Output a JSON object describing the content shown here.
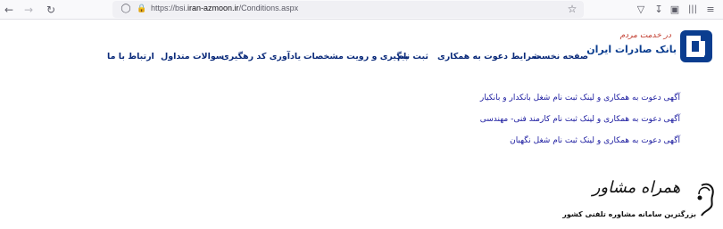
{
  "browser": {
    "url_prefix": "https://bsi.",
    "url_host": "iran-azmoon.ir",
    "url_path": "/Conditions.aspx",
    "icons": [
      "back-arrow-icon",
      "forward-arrow-icon",
      "reload-icon",
      "shield-icon",
      "lock-icon",
      "bookmark-star-icon",
      "pocket-icon",
      "download-icon",
      "extensions-icon",
      "library-icon",
      "hamburger-menu-icon"
    ]
  },
  "site": {
    "logo_name": "بانک صادرات ایران",
    "logo_slogan": "در خدمت مردم",
    "brand_color": "#0a3d8f",
    "menu": [
      "صفحه نخست",
      "شرایط دعوت به همکاری",
      "ثبت نام",
      "پیگیری و رویت مشخصات",
      "یادآوری کد رهگیری",
      "سوالات متداول",
      "ارتباط با ما"
    ]
  },
  "content": {
    "links": [
      "آگهی دعوت به همکاری و لینک ثبت نام شغل بانکدار و بانکیار",
      "آگهی دعوت به همکاری و لینک ثبت نام کارمند فنی- مهندسی",
      "آگهی دعوت به همکاری و لینک ثبت نام شغل نگهبان"
    ]
  },
  "watermark": {
    "logo_text": "همراه مشاور",
    "tagline": "بزرگترین سامانه مشاوره تلفنی کشور"
  }
}
